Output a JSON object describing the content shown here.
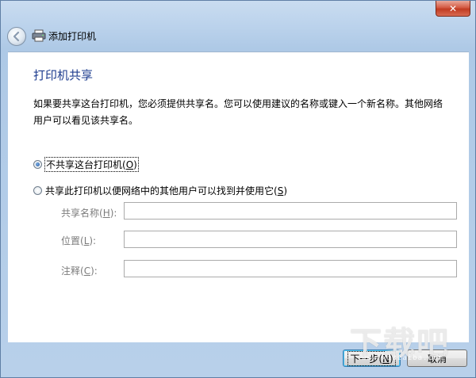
{
  "window": {
    "title": "添加打印机",
    "close_glyph": "✕"
  },
  "page": {
    "heading": "打印机共享",
    "description": "如果要共享这台打印机，您必须提供共享名。您可以使用建议的名称或键入一个新名称。其他网络用户可以看见该共享名。"
  },
  "options": [
    {
      "label_before": "不共享这台打印机(",
      "accel": "O",
      "label_after": ")",
      "checked": true
    },
    {
      "label_before": "共享此打印机以便网络中的其他用户可以找到并使用它(",
      "accel": "S",
      "label_after": ")",
      "checked": false
    }
  ],
  "fields": [
    {
      "label_before": "共享名称(",
      "accel": "H",
      "label_after": "):",
      "value": ""
    },
    {
      "label_before": "位置(",
      "accel": "L",
      "label_after": "):",
      "value": ""
    },
    {
      "label_before": "注释(",
      "accel": "C",
      "label_after": "):",
      "value": ""
    }
  ],
  "buttons": {
    "next": {
      "label_before": "下一步(",
      "accel": "N",
      "label_after": ")"
    },
    "cancel": {
      "label": "取消"
    }
  },
  "watermark": {
    "text": "下载吧",
    "sub": "www.xiazaiba.com"
  },
  "icons": {
    "back": "back-arrow-icon",
    "printer": "printer-icon",
    "close": "close-icon"
  }
}
